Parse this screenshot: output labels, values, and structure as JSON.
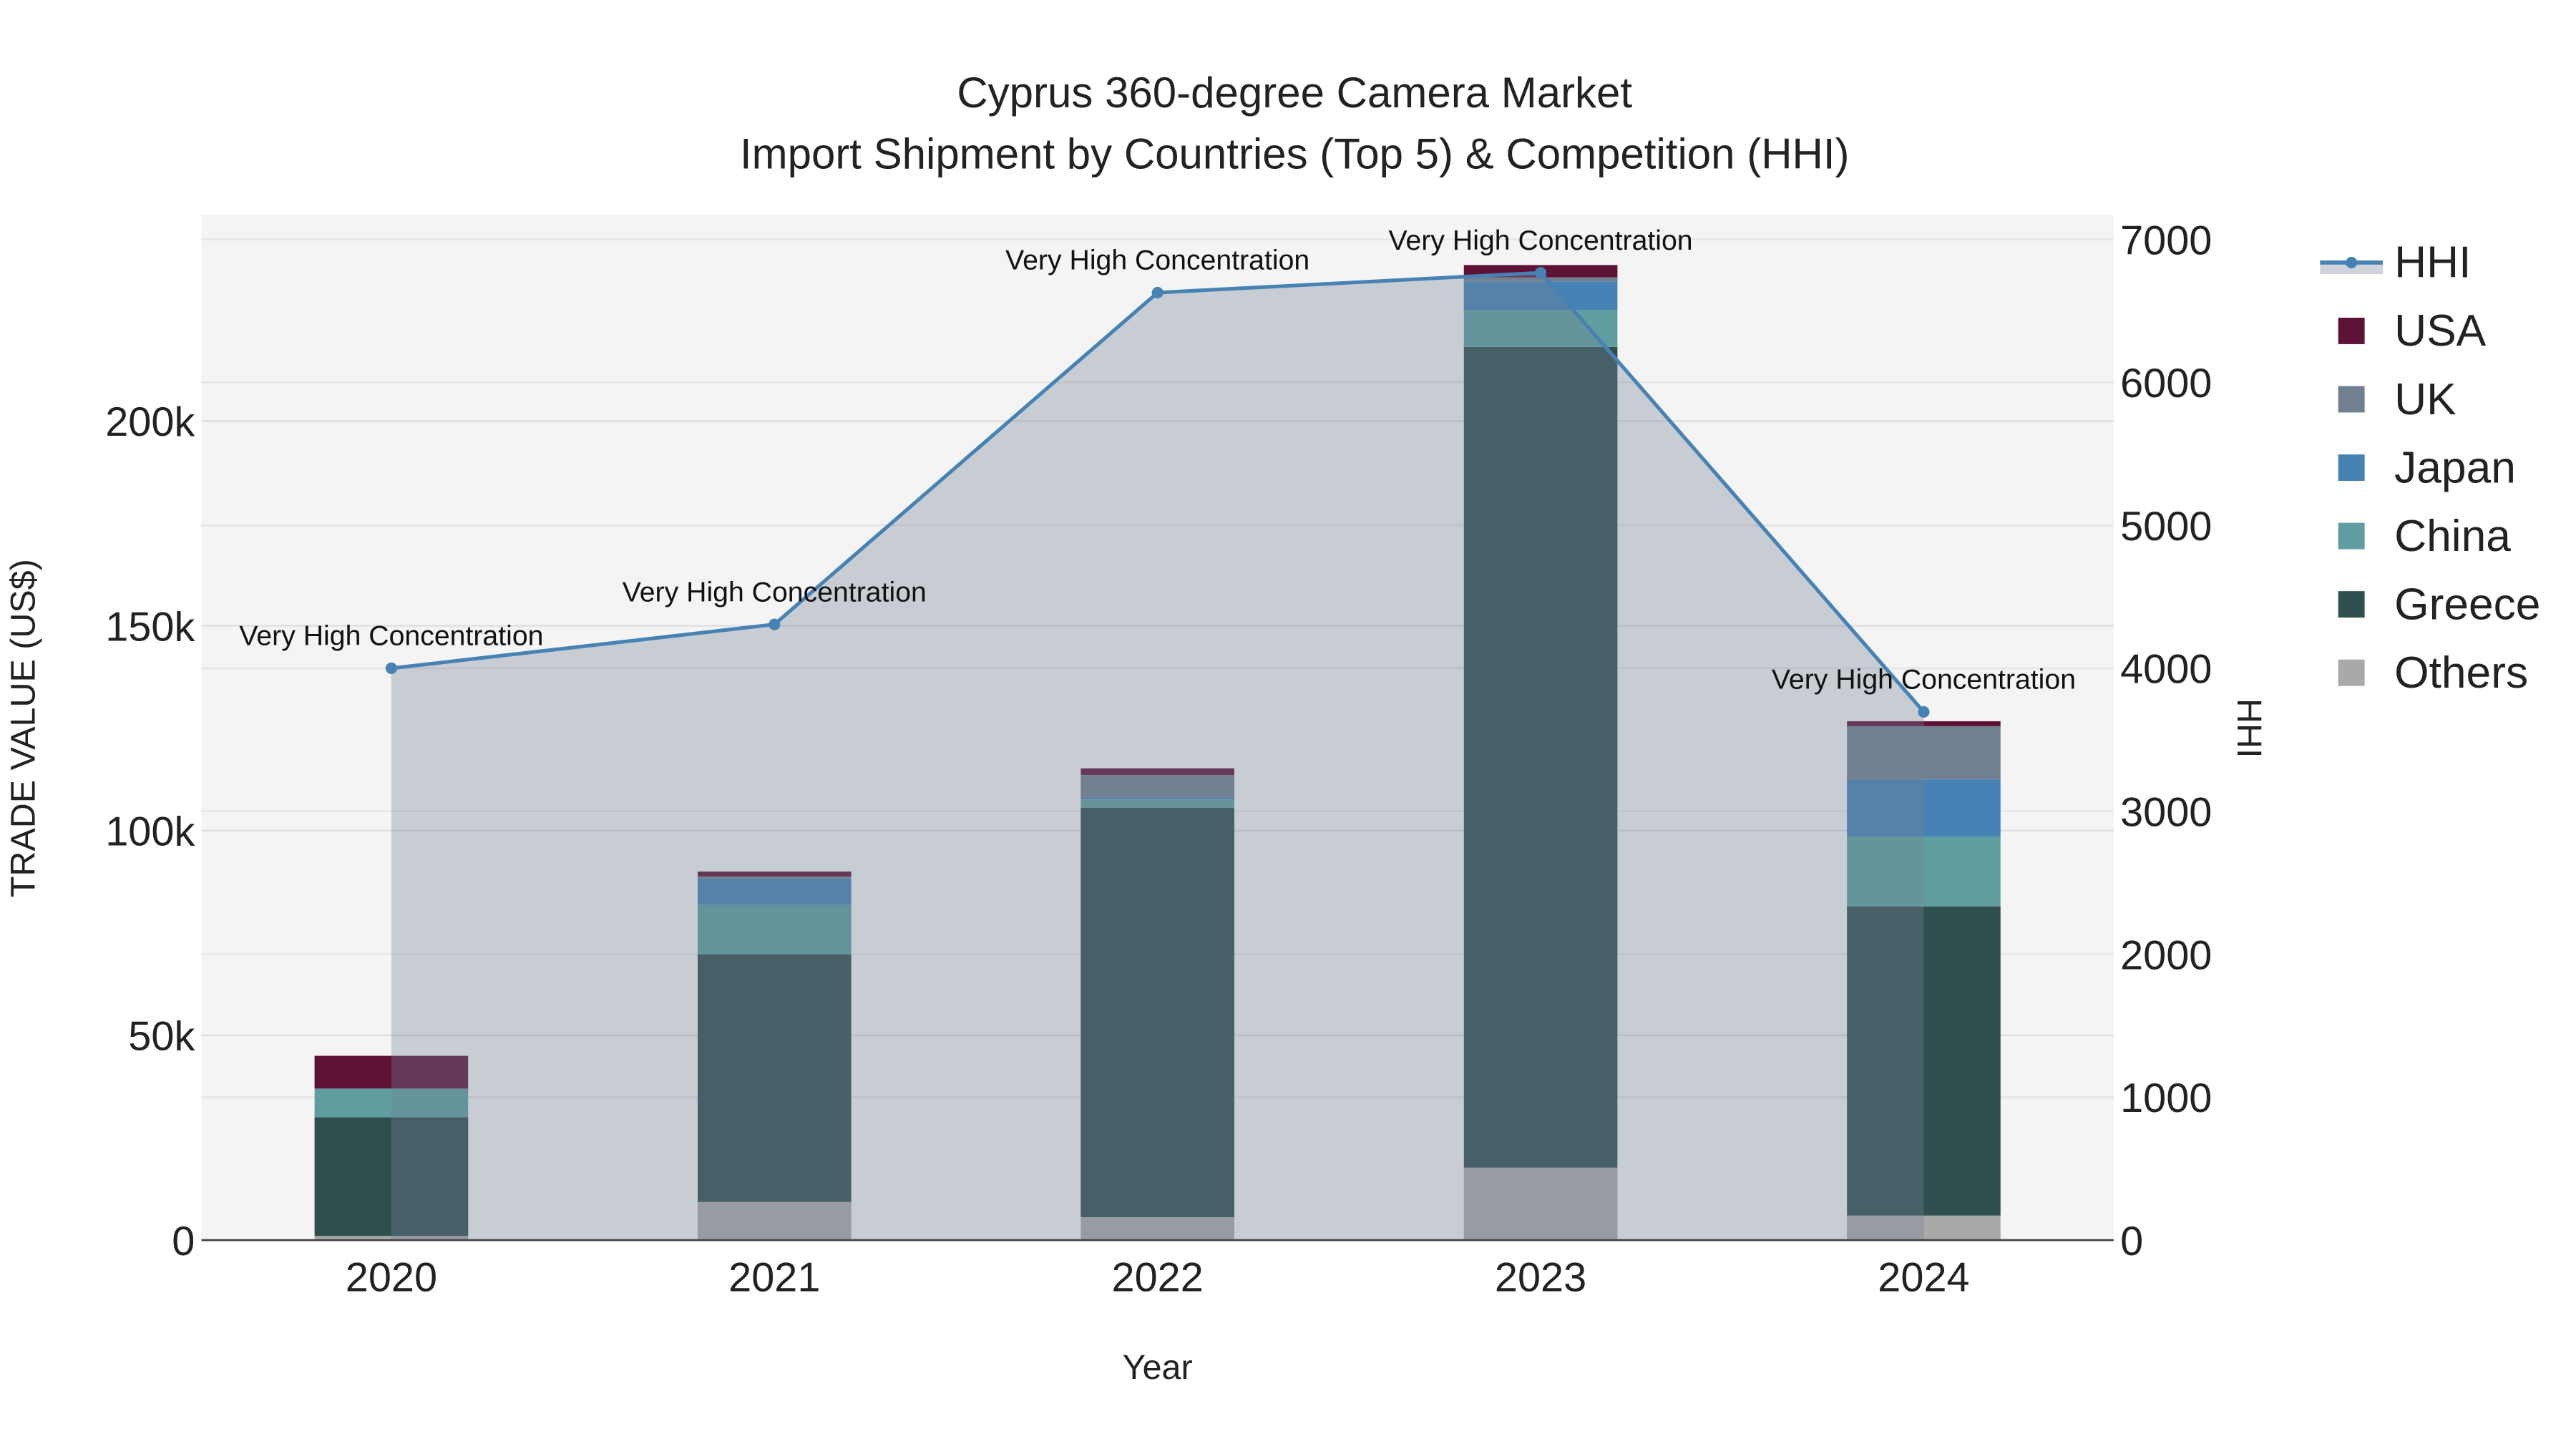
{
  "chart_data": {
    "type": "bar",
    "title": "Cyprus 360-degree Camera Market",
    "subtitle": "Import Shipment by Countries (Top 5) & Competition (HHI)",
    "xlabel": "Year",
    "ylabel": "TRADE VALUE (US$)",
    "y2label": "HHI",
    "categories": [
      "2020",
      "2021",
      "2022",
      "2023",
      "2024"
    ],
    "ylim": [
      0,
      250000
    ],
    "y2lim": [
      0,
      7150
    ],
    "yticks": [
      0,
      50000,
      100000,
      150000,
      200000
    ],
    "ytick_labels": [
      "0",
      "50k",
      "100k",
      "150k",
      "200k"
    ],
    "y2ticks": [
      0,
      1000,
      2000,
      3000,
      4000,
      5000,
      6000,
      7000
    ],
    "y2tick_labels": [
      "0",
      "1000",
      "2000",
      "3000",
      "4000",
      "5000",
      "6000",
      "7000"
    ],
    "stacked": true,
    "series": [
      {
        "name": "Others",
        "color": "#a9a9a9",
        "values": [
          1000,
          9300,
          5600,
          17700,
          6000
        ]
      },
      {
        "name": "Greece",
        "color": "#2f4f4f",
        "values": [
          29000,
          60500,
          100000,
          200400,
          75500
        ]
      },
      {
        "name": "China",
        "color": "#5f9ea0",
        "values": [
          7000,
          12100,
          2000,
          9000,
          17000
        ]
      },
      {
        "name": "Japan",
        "color": "#4682b4",
        "values": [
          0,
          6400,
          500,
          7000,
          14000
        ]
      },
      {
        "name": "UK",
        "color": "#708090",
        "values": [
          0,
          500,
          5500,
          1000,
          13000
        ]
      },
      {
        "name": "USA",
        "color": "#5e1236",
        "values": [
          8000,
          1200,
          1600,
          3000,
          1200
        ]
      }
    ],
    "line": {
      "name": "HHI",
      "axis": "y2",
      "color": "#4682b4",
      "values": [
        4000,
        4307,
        6628,
        6767,
        3695
      ]
    },
    "annotations": [
      "Very High Concentration",
      "Very High Concentration",
      "Very High Concentration",
      "Very High Concentration",
      "Very High Concentration"
    ],
    "legend_order": [
      "HHI",
      "USA",
      "UK",
      "Japan",
      "China",
      "Greece",
      "Others"
    ],
    "legend_position": "right",
    "grid": true
  }
}
